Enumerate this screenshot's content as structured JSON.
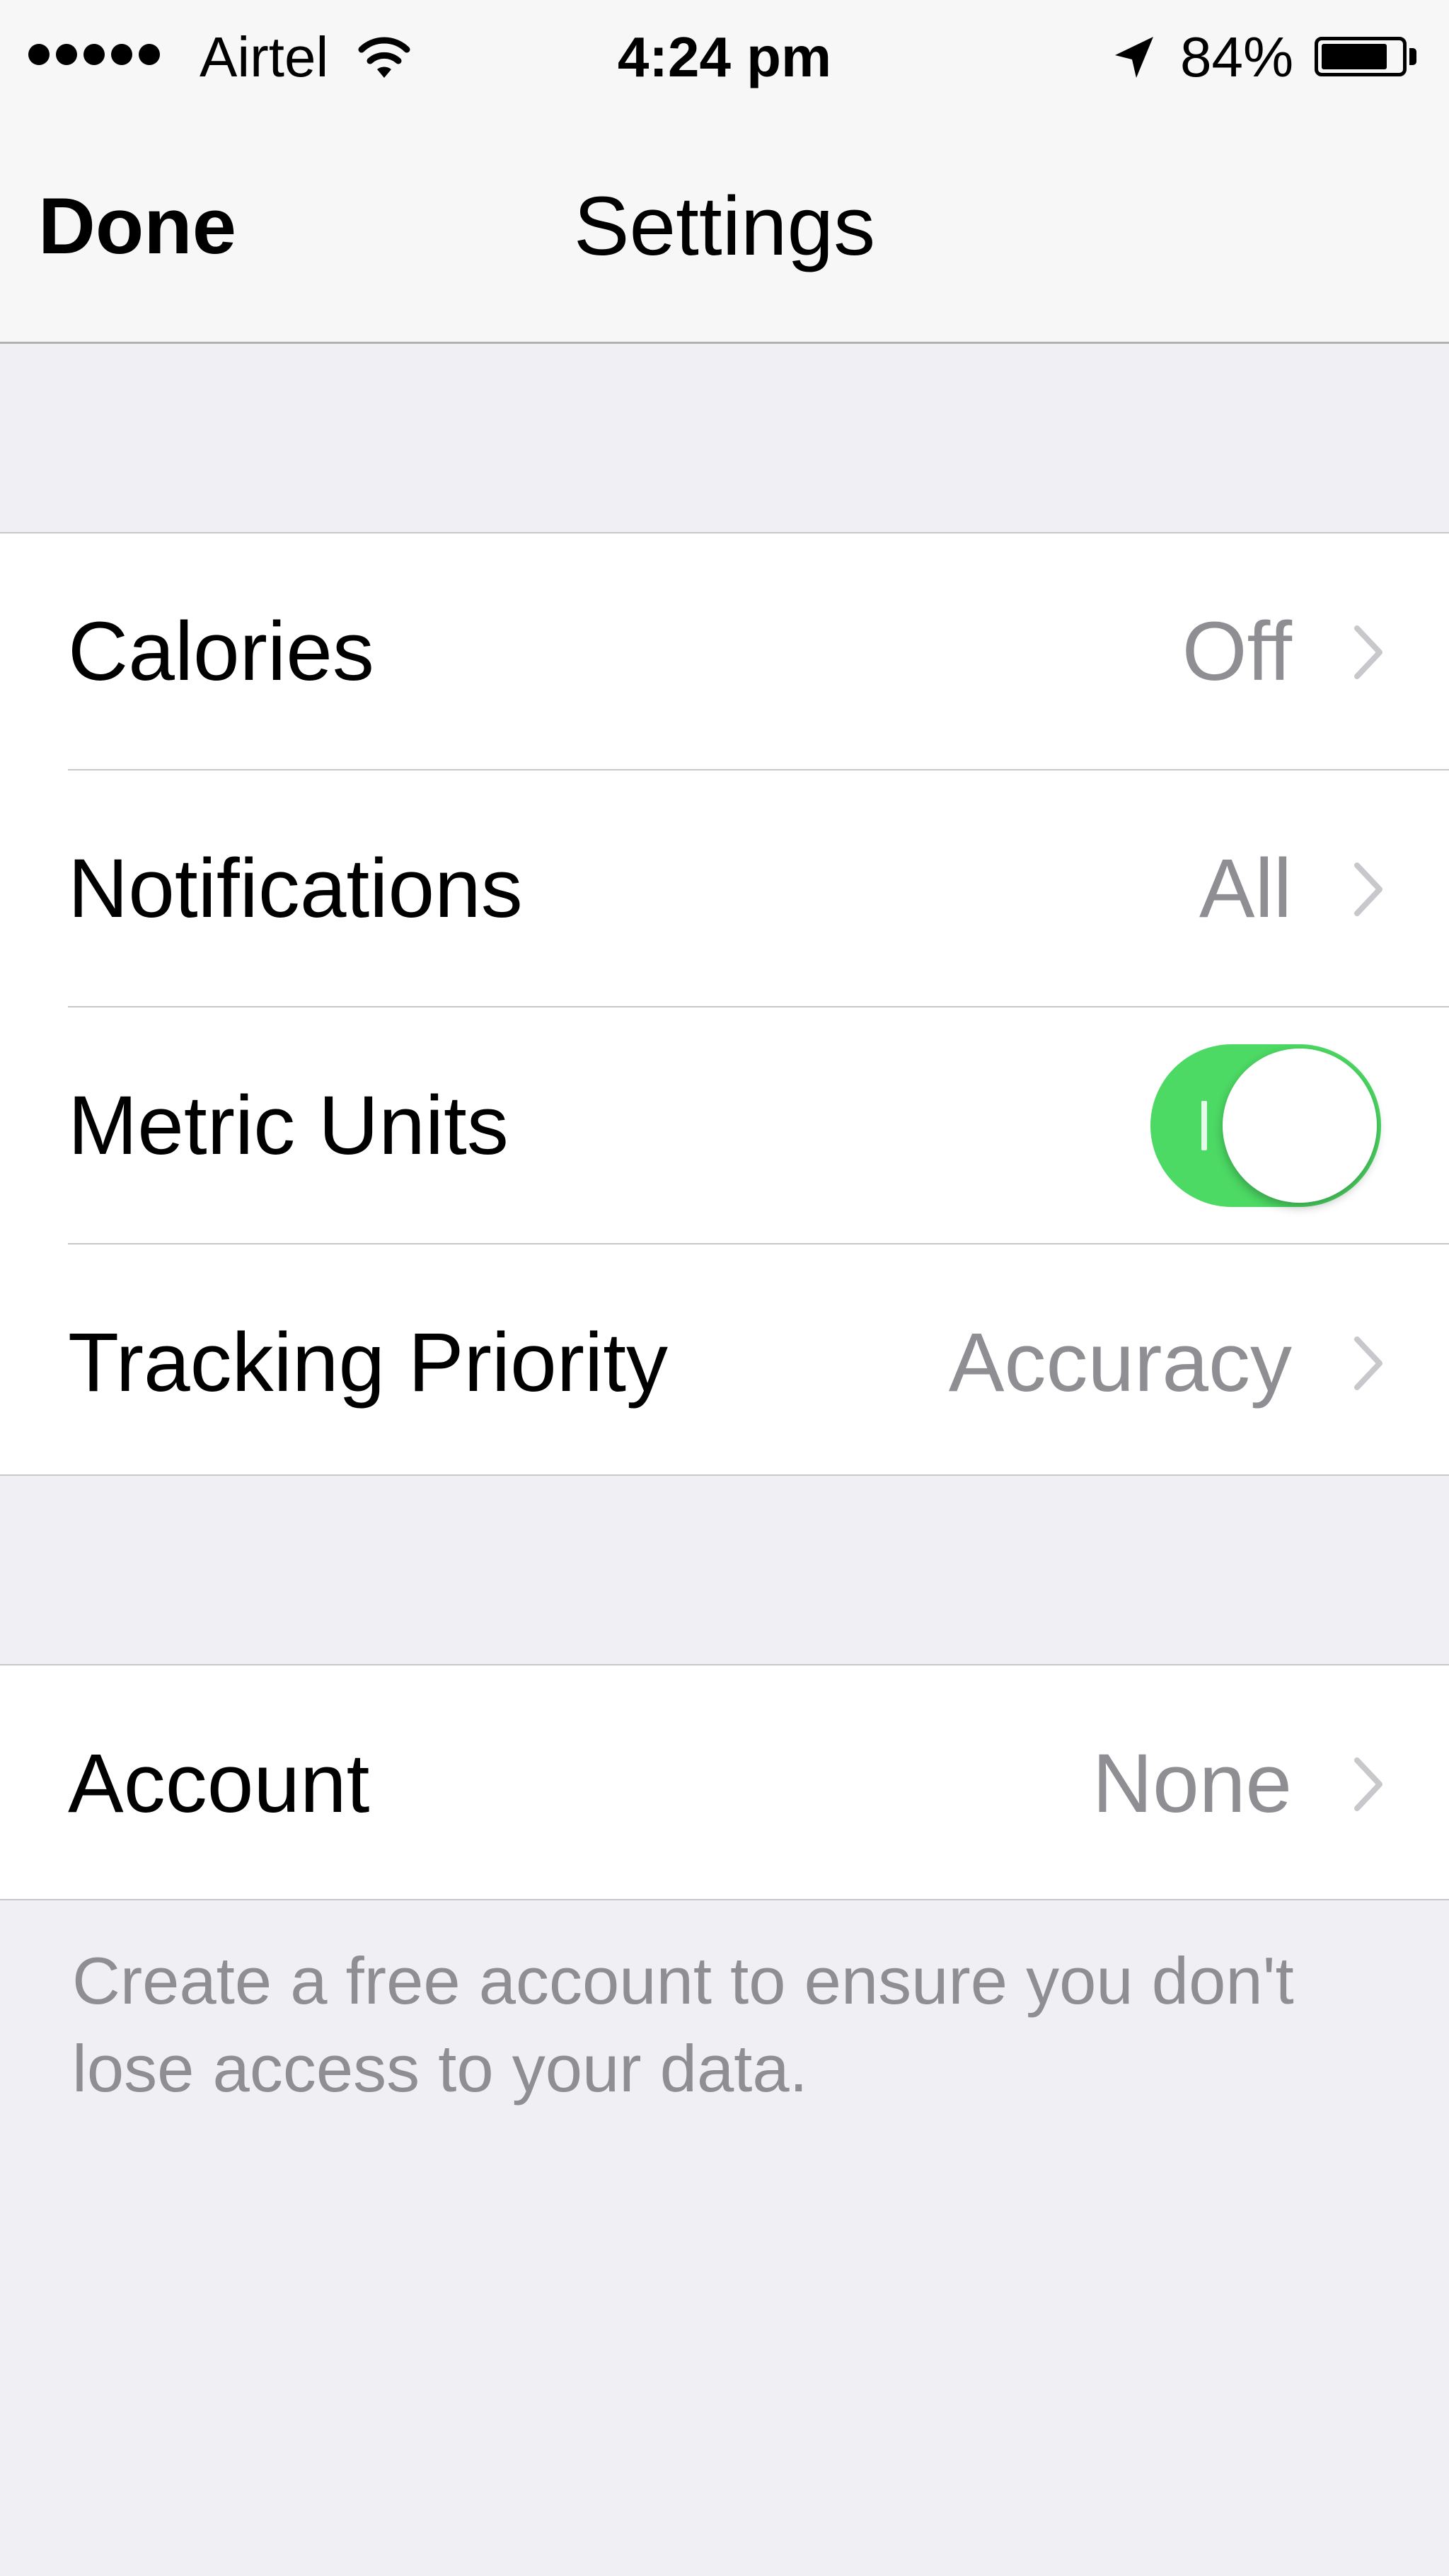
{
  "status_bar": {
    "carrier": "Airtel",
    "signal_dots": 5,
    "time": "4:24 pm",
    "battery_percent_label": "84%",
    "battery_level": 0.84,
    "icons": [
      "signal-dots-icon",
      "wifi-icon",
      "location-arrow-icon",
      "battery-icon"
    ]
  },
  "nav": {
    "done_label": "Done",
    "title": "Settings"
  },
  "settings": {
    "rows": [
      {
        "label": "Calories",
        "value": "Off",
        "type": "disclosure"
      },
      {
        "label": "Notifications",
        "value": "All",
        "type": "disclosure"
      },
      {
        "label": "Metric Units",
        "type": "toggle",
        "toggle_on": true
      },
      {
        "label": "Tracking Priority",
        "value": "Accuracy",
        "type": "disclosure"
      }
    ]
  },
  "account": {
    "label": "Account",
    "value": "None",
    "footer": "Create a free account to ensure you don't lose access to your data."
  },
  "colors": {
    "background": "#efeff4",
    "bar": "#f7f7f7",
    "toggle_on": "#4cd964",
    "secondary_text": "#8e8e93",
    "separator": "#c8c7cc"
  }
}
